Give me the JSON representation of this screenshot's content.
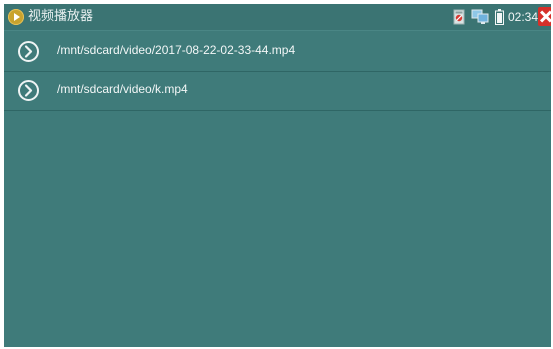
{
  "status_bar": {
    "app_title": "视频播放器",
    "clock": "02:34",
    "icons": [
      "video-player-icon",
      "record-indicator-icon",
      "network-icon",
      "battery-icon",
      "close-icon"
    ],
    "close_color": "#d6302a"
  },
  "file_list": {
    "items": [
      {
        "path": "/mnt/sdcard/video/2017-08-22-02-33-44.mp4"
      },
      {
        "path": "/mnt/sdcard/video/k.mp4"
      }
    ]
  },
  "colors": {
    "background": "#3f7b7a",
    "status_bar": "#3b7473",
    "text": "#f3f7f7"
  }
}
